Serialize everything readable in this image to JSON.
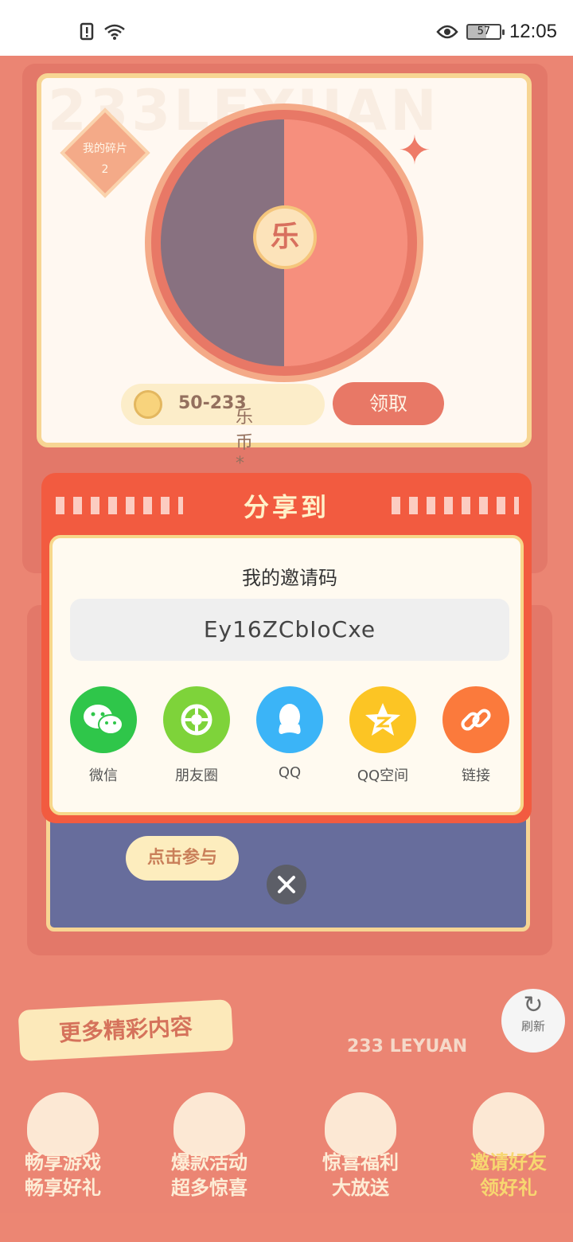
{
  "status_bar": {
    "time": "12:05",
    "battery": "57"
  },
  "background": {
    "brand_watermark": "233LEYUAN",
    "fragments_label": "我的碎片",
    "fragments_count": "2",
    "wheel_center": "乐",
    "coin_reward_prefix": "乐币*",
    "coin_reward_value": "50-233",
    "claim_button": "领取",
    "join_button": "点击参与",
    "more_content_title": "更多精彩内容",
    "brand_text": "233 LEYUAN",
    "refresh_label": "刷新",
    "bottom_nav": [
      {
        "line1": "畅享游戏",
        "line2": "畅享好礼"
      },
      {
        "line1": "爆款活动",
        "line2": "超多惊喜"
      },
      {
        "line1": "惊喜福利",
        "line2": "大放送"
      },
      {
        "line1": "邀请好友",
        "line2": "领好礼"
      }
    ]
  },
  "dialog": {
    "title": "分享到",
    "invite_code_label": "我的邀请码",
    "invite_code": "Ey16ZCbIoCxe",
    "share_options": [
      {
        "label": "微信",
        "icon": "wechat-icon",
        "color": "#2fc64a"
      },
      {
        "label": "朋友圈",
        "icon": "moments-icon",
        "color": "#7ed33a"
      },
      {
        "label": "QQ",
        "icon": "qq-icon",
        "color": "#3bb4f7"
      },
      {
        "label": "QQ空间",
        "icon": "qzone-icon",
        "color": "#fcc524"
      },
      {
        "label": "链接",
        "icon": "link-icon",
        "color": "#fb7a3c"
      }
    ]
  },
  "colors": {
    "primary": "#f25b40",
    "background": "#e4573d",
    "accent": "#f7d78a"
  }
}
